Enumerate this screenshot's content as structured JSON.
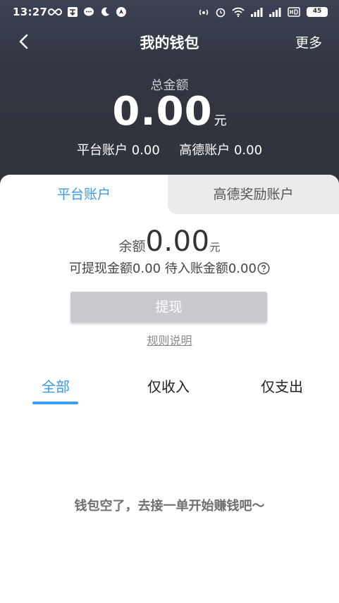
{
  "status_bar": {
    "time": "13:27",
    "battery": "45"
  },
  "nav": {
    "title": "我的钱包",
    "more_label": "更多"
  },
  "summary": {
    "total_label": "总金额",
    "total_amount": "0.00",
    "total_unit": "元",
    "platform_account_label": "平台账户",
    "platform_account_value": "0.00",
    "amap_account_label": "高德账户",
    "amap_account_value": "0.00"
  },
  "tabs": [
    {
      "label": "平台账户",
      "active": true
    },
    {
      "label": "高德奖励账户",
      "active": false
    }
  ],
  "balance": {
    "label": "余额",
    "amount": "0.00",
    "unit": "元",
    "withdrawable_label": "可提现金额",
    "withdrawable_value": "0.00",
    "pending_label": "待入账金额",
    "pending_value": "0.00"
  },
  "actions": {
    "withdraw_label": "提现",
    "rules_label": "规则说明"
  },
  "filters": [
    {
      "label": "全部",
      "active": true
    },
    {
      "label": "仅收入",
      "active": false
    },
    {
      "label": "仅支出",
      "active": false
    }
  ],
  "empty_message": "钱包空了，去接一单开始赚钱吧〜",
  "colors": {
    "header_bg": "#303238",
    "accent": "#3a9bea",
    "button_disabled": "#c9cace",
    "inactive_tab_bg": "#ebebed"
  }
}
